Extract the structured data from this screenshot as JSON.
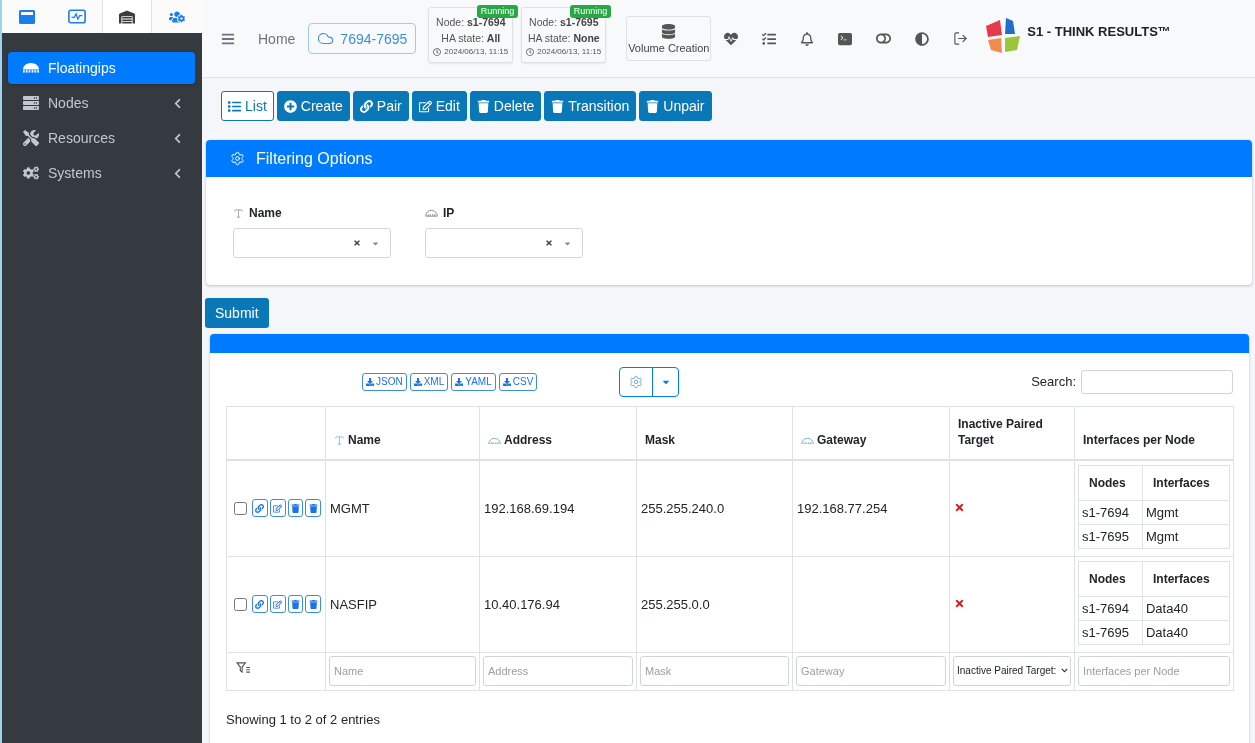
{
  "sidebar": {
    "tabs": [
      {
        "selected": false
      },
      {
        "selected": false
      },
      {
        "selected": true
      },
      {
        "selected": false
      }
    ],
    "items": [
      {
        "kind": "link",
        "label": "Floatingips",
        "selected": true
      },
      {
        "kind": "menu",
        "label": "Nodes",
        "selected": false,
        "expanded": false
      },
      {
        "kind": "menu",
        "label": "Resources",
        "selected": false,
        "expanded": false
      },
      {
        "kind": "menu",
        "label": "Systems",
        "selected": false,
        "expanded": false
      }
    ]
  },
  "header": {
    "home": "Home",
    "cluster": "7694-7695",
    "nodes": [
      {
        "status": "Running",
        "node": "Node: **s1-7694**",
        "ha_state": "HA state: **All**",
        "time": "2024/06/13, 11:15"
      },
      {
        "status": "Running",
        "node": "Node: **s1-7695**",
        "ha_state": "HA state: **None**",
        "time": "2024/06/13, 11:15"
      }
    ],
    "volume_creation": "Volume Creation",
    "brand": "S1 - THINK RESULTS™"
  },
  "toolbar": [
    {
      "label": "List",
      "selected": true
    },
    {
      "label": "Create",
      "selected": false
    },
    {
      "label": "Pair",
      "selected": false
    },
    {
      "label": "Edit",
      "selected": false
    },
    {
      "label": "Delete",
      "selected": false
    },
    {
      "label": "Transition",
      "selected": false
    },
    {
      "label": "Unpair",
      "selected": false
    }
  ],
  "filter_panel": {
    "title": "Filtering Options",
    "fields": [
      {
        "kind": "text",
        "label": "Name"
      },
      {
        "kind": "network",
        "label": "IP"
      }
    ]
  },
  "submit": "Submit",
  "table": {
    "exports": [
      "JSON",
      "XML",
      "YAML",
      "CSV"
    ],
    "search_label": "Search:",
    "columns": [
      {
        "kind": "text",
        "label": "Name"
      },
      {
        "kind": "network",
        "label": "Address"
      },
      {
        "kind": "plain",
        "label": "Mask"
      },
      {
        "kind": "network",
        "label": "Gateway"
      },
      {
        "kind": "plain",
        "label": "Inactive Paired Target"
      },
      {
        "kind": "plain",
        "label": "Interfaces per Node"
      }
    ],
    "rows": [
      {
        "selected": false,
        "name": "MGMT",
        "address": "192.168.69.194",
        "mask": "255.255.240.0",
        "gateway": "192.168.77.254",
        "inactive_paired_target": false,
        "interfaces": {
          "columns": [
            "Nodes",
            "Interfaces"
          ],
          "rows": [
            [
              "s1-7694",
              "Mgmt"
            ],
            [
              "s1-7695",
              "Mgmt"
            ]
          ]
        }
      },
      {
        "selected": false,
        "name": "NASFIP",
        "address": "10.40.176.94",
        "mask": "255.255.0.0",
        "inactive_paired_target": false,
        "interfaces": {
          "columns": [
            "Nodes",
            "Interfaces"
          ],
          "rows": [
            [
              "s1-7694",
              "Data40"
            ],
            [
              "s1-7695",
              "Data40"
            ]
          ]
        }
      }
    ],
    "filters": [
      {
        "kind": "input",
        "placeholder": "Name"
      },
      {
        "kind": "input",
        "placeholder": "Address"
      },
      {
        "kind": "input",
        "placeholder": "Mask"
      },
      {
        "kind": "input",
        "placeholder": "Gateway"
      },
      {
        "kind": "select",
        "value": "Inactive Paired Target:"
      },
      {
        "kind": "input",
        "placeholder": "Interfaces per Node"
      }
    ],
    "info": "Showing 1 to 2 of 2 entries"
  }
}
